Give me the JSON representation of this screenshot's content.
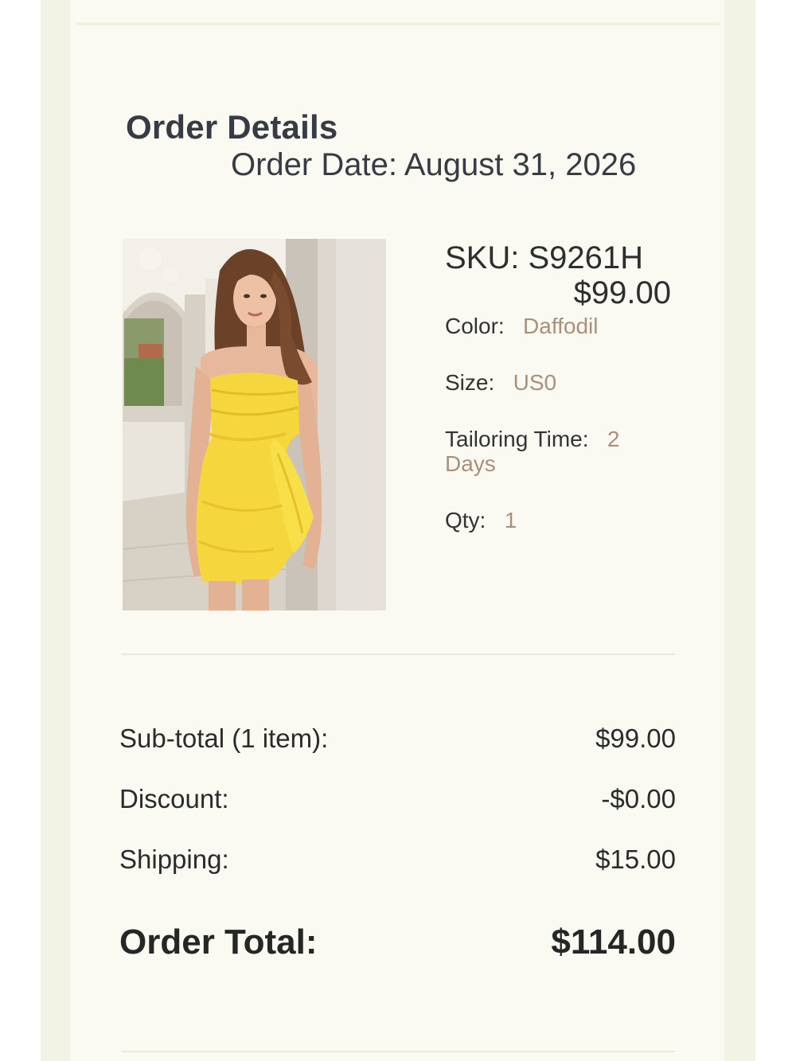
{
  "order": {
    "title": "Order Details",
    "date_line": "Order Date: August 31, 2026"
  },
  "item": {
    "image_name": "yellow-strapless-dress-photo",
    "sku": "SKU: S9261H",
    "price": "$99.00",
    "attributes": [
      {
        "label": "Color:",
        "value": "Daffodil"
      },
      {
        "label": "Size:",
        "value": "US0"
      },
      {
        "label": "Tailoring Time:",
        "value": "2 Days"
      },
      {
        "label": "Qty:",
        "value": "1"
      }
    ]
  },
  "summary": {
    "subtotal_label": "Sub-total (1 item):",
    "subtotal_value": "$99.00",
    "discount_label": "Discount:",
    "discount_value": "-$0.00",
    "shipping_label": "Shipping:",
    "shipping_value": "$15.00",
    "total_label": "Order Total:",
    "total_value": "$114.00"
  },
  "colors": {
    "card_background": "#fafaf2",
    "outer_background": "#f2f3e4",
    "heading_text": "#363b44",
    "attribute_value": "#ad8f78",
    "dress_yellow": "#f5d63c"
  }
}
